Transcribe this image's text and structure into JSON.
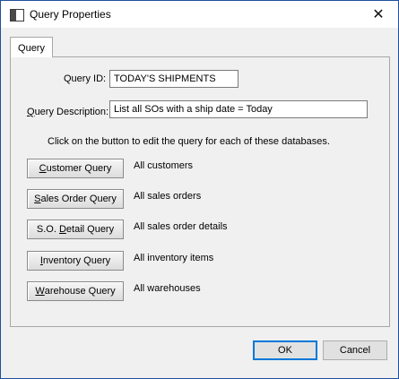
{
  "window": {
    "title": "Query Properties",
    "close_glyph": "✕"
  },
  "tabs": [
    {
      "label": "Query"
    }
  ],
  "form": {
    "query_id_label": "Query ID:",
    "query_id_value": "TODAY'S SHIPMENTS",
    "query_description_label_prefix": "Q",
    "query_description_label_rest": "uery Description:",
    "query_description_value": "List all SOs with a ship date = Today",
    "instruction": "Click on the button to edit the query for each of these databases."
  },
  "queries": [
    {
      "mnemonic": "C",
      "rest": "ustomer Query",
      "description": "All customers"
    },
    {
      "mnemonic": "S",
      "rest": "ales Order Query",
      "description": "All sales orders"
    },
    {
      "pre": "S.O. ",
      "mnemonic": "D",
      "rest": "etail Query",
      "description": "All sales order details"
    },
    {
      "mnemonic": "I",
      "rest": "nventory Query",
      "description": "All inventory items"
    },
    {
      "mnemonic": "W",
      "rest": "arehouse Query",
      "description": "All warehouses"
    }
  ],
  "buttons": {
    "ok": "OK",
    "cancel": "Cancel"
  },
  "colors": {
    "window_border": "#1f4f9b",
    "default_button_border": "#0078d7",
    "dialog_bg": "#f0f0f0"
  },
  "icons": {
    "title": "window-app-icon",
    "close": "close-icon"
  }
}
